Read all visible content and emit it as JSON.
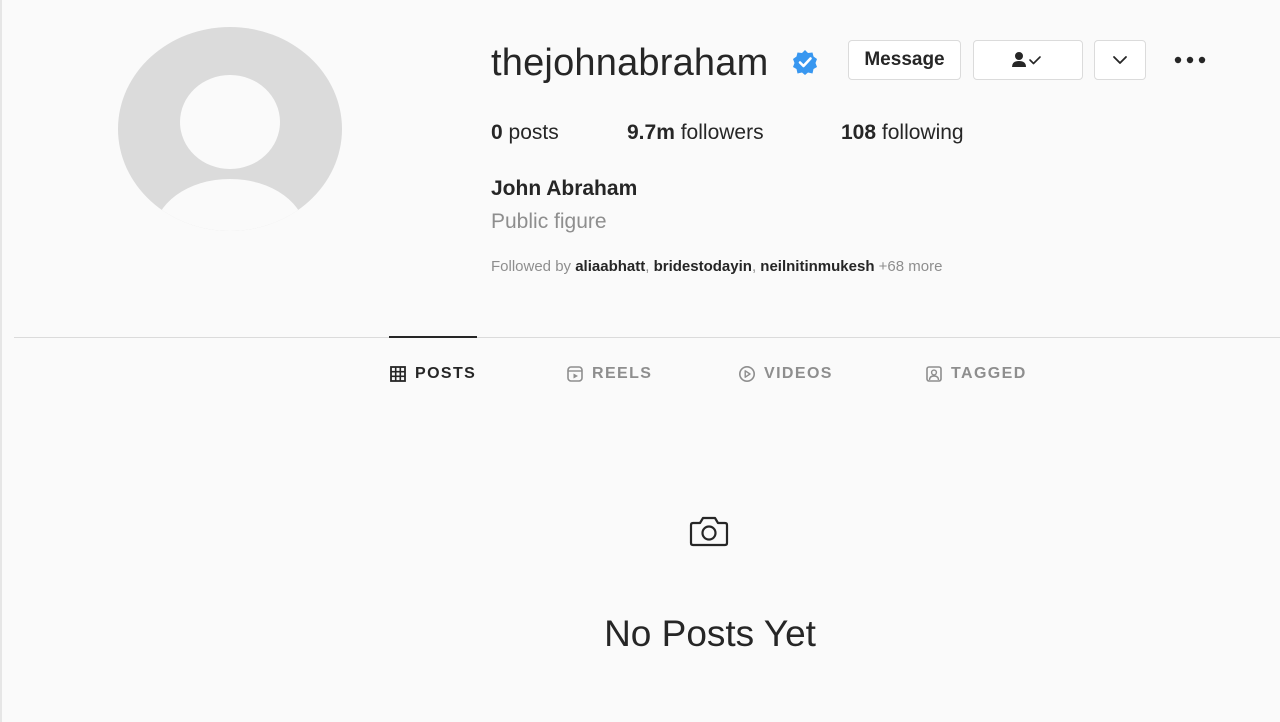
{
  "profile": {
    "username": "thejohnabraham",
    "verified": true,
    "full_name": "John Abraham",
    "category": "Public figure",
    "avatar_icon": "default-avatar-icon"
  },
  "actions": {
    "message_label": "Message",
    "following_icon": "person-check-icon",
    "suggest_icon": "chevron-down-icon",
    "more_icon": "more-horizontal-icon"
  },
  "stats": {
    "posts_count": "0",
    "posts_label": "posts",
    "followers_count": "9.7m",
    "followers_label": "followers",
    "following_count": "108",
    "following_label": "following"
  },
  "followed_by": {
    "prefix": "Followed by",
    "names": [
      "aliaabhatt",
      "bridestodayin",
      "neilnitinmukesh"
    ],
    "more": "+68 more"
  },
  "tabs": [
    {
      "label": "POSTS",
      "icon": "grid-icon",
      "active": true
    },
    {
      "label": "REELS",
      "icon": "reels-icon",
      "active": false
    },
    {
      "label": "VIDEOS",
      "icon": "play-circle-icon",
      "active": false
    },
    {
      "label": "TAGGED",
      "icon": "tagged-icon",
      "active": false
    }
  ],
  "empty_state": {
    "icon": "camera-icon",
    "title": "No Posts Yet"
  },
  "colors": {
    "background": "#fafafa",
    "text": "#262626",
    "secondary": "#8e8e8e",
    "border": "#dbdbdb",
    "verified_blue": "#3897f0"
  }
}
